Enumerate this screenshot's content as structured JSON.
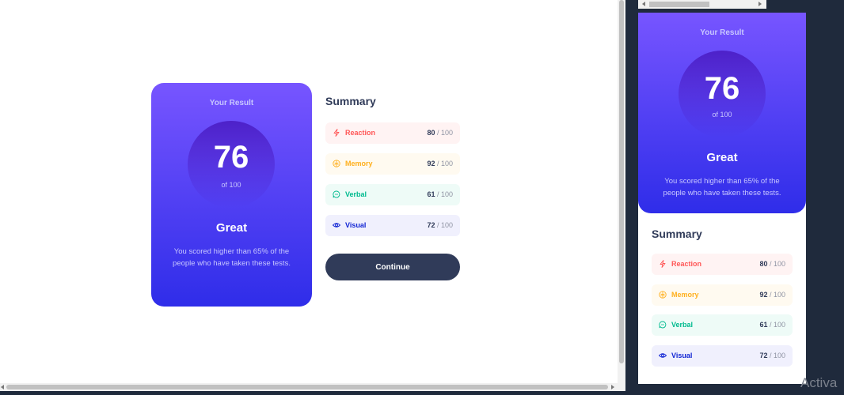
{
  "result": {
    "title": "Your Result",
    "score": "76",
    "of": "of 100",
    "grade": "Great",
    "description": "You scored higher than 65% of the people who have taken these tests."
  },
  "summary": {
    "title": "Summary",
    "items": [
      {
        "label": "Reaction",
        "score": "80",
        "total": " / 100",
        "icon": "bolt-icon",
        "color": "#ff5757",
        "bg": "#fff3f3"
      },
      {
        "label": "Memory",
        "score": "92",
        "total": " / 100",
        "icon": "brain-icon",
        "color": "#ffb01f",
        "bg": "#fffaf0"
      },
      {
        "label": "Verbal",
        "score": "61",
        "total": " / 100",
        "icon": "chat-icon",
        "color": "#00bb8f",
        "bg": "#eefbf7"
      },
      {
        "label": "Visual",
        "score": "72",
        "total": " / 100",
        "icon": "eye-icon",
        "color": "#1125d4",
        "bg": "#f0f0fd"
      }
    ]
  },
  "continue_label": "Continue",
  "watermark": "Activa"
}
